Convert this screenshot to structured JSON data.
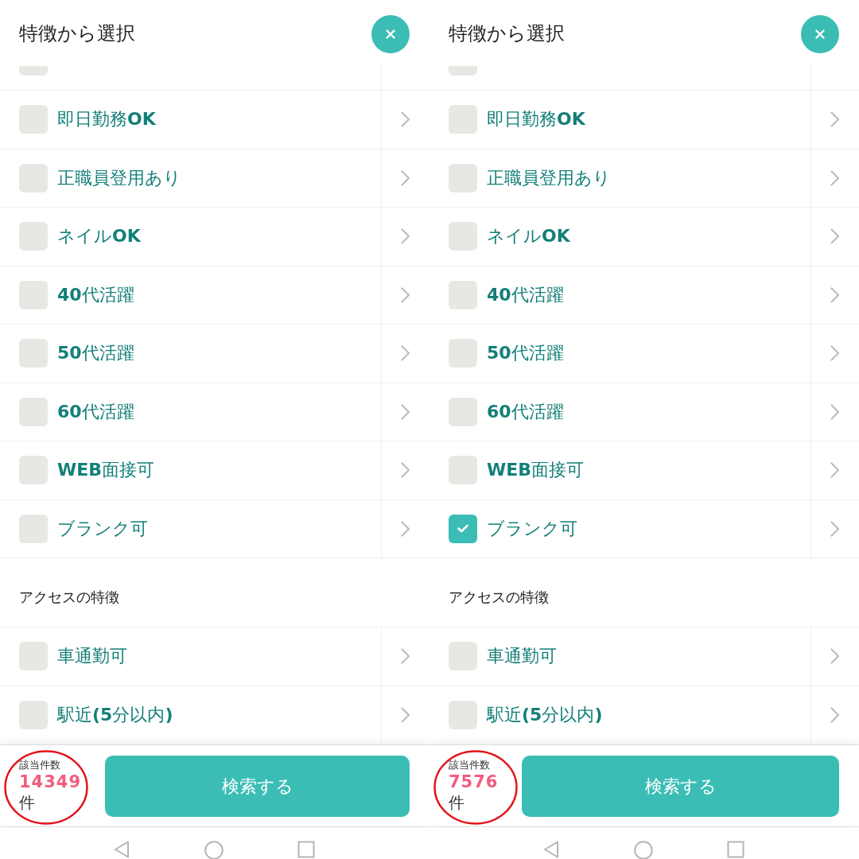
{
  "panels": [
    {
      "header": {
        "title": "特徴から選択"
      },
      "groups": [
        {
          "items": [
            {
              "kind": "clipped",
              "checked": false
            },
            {
              "kind": "option",
              "label": "即日勤務**OK**",
              "checked": false
            },
            {
              "kind": "option",
              "label": "正職員登用あり",
              "checked": false
            },
            {
              "kind": "option",
              "label": "ネイル**OK**",
              "checked": false
            },
            {
              "kind": "option",
              "label": "**40**代活躍",
              "checked": false
            },
            {
              "kind": "option",
              "label": "**50**代活躍",
              "checked": false
            },
            {
              "kind": "option",
              "label": "**60**代活躍",
              "checked": false
            },
            {
              "kind": "option",
              "label": "**WEB**面接可",
              "checked": false
            },
            {
              "kind": "option",
              "label": "ブランク可",
              "checked": false
            }
          ]
        },
        {
          "heading": "アクセスの特徴",
          "items": [
            {
              "kind": "option",
              "label": "車通勤可",
              "checked": false
            },
            {
              "kind": "option",
              "label": "駅近**(5**分以内**)**",
              "checked": false
            }
          ]
        }
      ],
      "footer": {
        "count_label": "該当件数",
        "count": "14349",
        "unit": "件",
        "count_circled": true,
        "search_button": "検索する"
      }
    },
    {
      "header": {
        "title": "特徴から選択"
      },
      "groups": [
        {
          "items": [
            {
              "kind": "clipped",
              "checked": false
            },
            {
              "kind": "option",
              "label": "即日勤務**OK**",
              "checked": false
            },
            {
              "kind": "option",
              "label": "正職員登用あり",
              "checked": false
            },
            {
              "kind": "option",
              "label": "ネイル**OK**",
              "checked": false
            },
            {
              "kind": "option",
              "label": "**40**代活躍",
              "checked": false
            },
            {
              "kind": "option",
              "label": "**50**代活躍",
              "checked": false
            },
            {
              "kind": "option",
              "label": "**60**代活躍",
              "checked": false
            },
            {
              "kind": "option",
              "label": "**WEB**面接可",
              "checked": false
            },
            {
              "kind": "option",
              "label": "ブランク可",
              "checked": true
            }
          ]
        },
        {
          "heading": "アクセスの特徴",
          "items": [
            {
              "kind": "option",
              "label": "車通勤可",
              "checked": false
            },
            {
              "kind": "option",
              "label": "駅近**(5**分以内**)**",
              "checked": false
            }
          ]
        }
      ],
      "footer": {
        "count_label": "該当件数",
        "count": "7576",
        "unit": "件",
        "count_circled": true,
        "search_button": "検索する"
      }
    }
  ]
}
